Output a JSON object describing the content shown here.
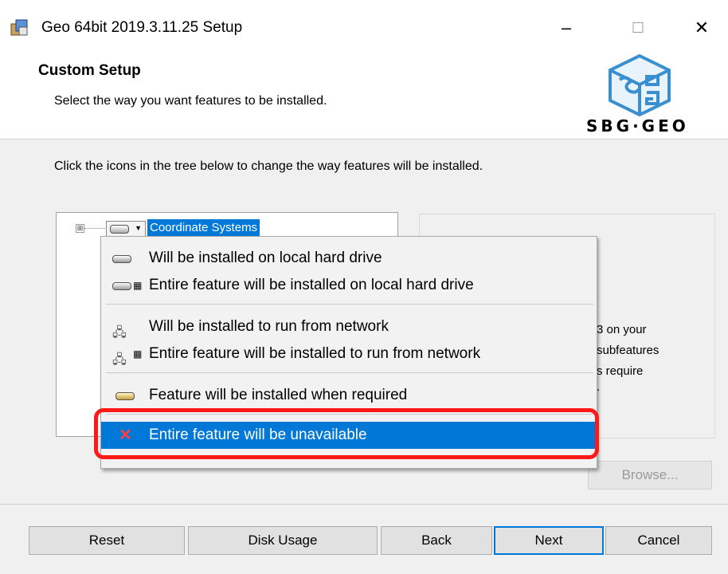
{
  "window": {
    "title": "Geo 64bit 2019.3.11.25 Setup",
    "controls": {
      "minimize": "–",
      "maximize": "☐",
      "close": "✕"
    }
  },
  "header": {
    "title": "Custom Setup",
    "subtitle": "Select the way you want features to be installed.",
    "logo_text": "SBG·GEO"
  },
  "instruction": "Click the icons in the tree below to change the way features will be installed.",
  "tree": {
    "expander": "⊞",
    "node_label": "Coordinate Systems"
  },
  "description_fragments": [
    "3 on your",
    "subfeatures",
    "s require",
    "."
  ],
  "menu": {
    "items": [
      {
        "label": "Will be installed on local hard drive",
        "icon": "hard-drive-icon"
      },
      {
        "label": "Entire feature will be installed on local hard drive",
        "icon": "hard-drive-all-icon"
      },
      {
        "label": "Will be installed to run from network",
        "icon": "network-icon"
      },
      {
        "label": "Entire feature will be installed to run from network",
        "icon": "network-all-icon"
      },
      {
        "label": "Feature will be installed when required",
        "icon": "install-on-demand-icon"
      },
      {
        "label": "Entire feature will be unavailable",
        "icon": "unavailable-x-icon",
        "highlighted": true
      }
    ],
    "x_glyph": "✕"
  },
  "buttons": {
    "browse": "Browse...",
    "reset": "Reset",
    "disk_usage": "Disk Usage",
    "back": "Back",
    "next": "Next",
    "cancel": "Cancel"
  },
  "colors": {
    "selection": "#0078d7",
    "highlight_ring": "#ff1a1a",
    "x_icon": "#ff4040"
  }
}
